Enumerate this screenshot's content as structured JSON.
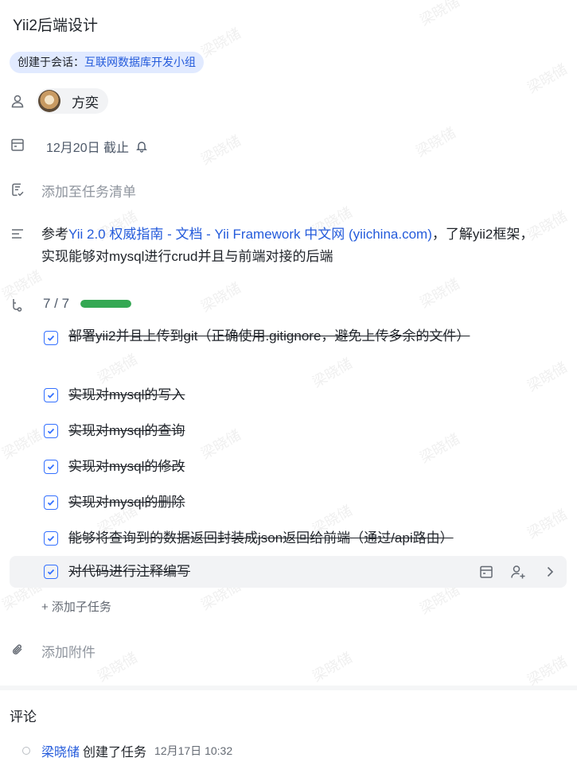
{
  "task": {
    "title": "Yii2后端设计",
    "chat_prefix": "创建于会话：",
    "chat_name": "互联网数据库开发小组",
    "assignee": "方奕",
    "due": "12月20日 截止",
    "add_to_list": "添加至任务清单",
    "description": {
      "prefix": "参考",
      "link_text": "Yii 2.0 权威指南 - 文档 - Yii Framework 中文网 (yiichina.com)",
      "suffix": "，了解yii2框架，实现能够对mysql进行crud并且与前端对接的后端"
    },
    "progress": {
      "label": "7 / 7",
      "fraction": 1.0,
      "color": "#34a853"
    },
    "subtasks": [
      {
        "text": "部署yii2并且上传到git（正确使用.gitignore，避免上传多余的文件）",
        "done": true
      },
      {
        "text": "实现对mysql的写入",
        "done": true
      },
      {
        "text": "实现对mysql的查询",
        "done": true
      },
      {
        "text": "实现对mysql的修改",
        "done": true
      },
      {
        "text": "实现对mysql的删除",
        "done": true
      },
      {
        "text": "能够将查询到的数据返回封装成json返回给前端（通过/api路由）",
        "done": true
      },
      {
        "text": "对代码进行注释编写",
        "done": true
      }
    ],
    "add_subtask": "+ 添加子任务",
    "add_attachment": "添加附件"
  },
  "comments": {
    "title": "评论",
    "activity": {
      "user": "梁晓储",
      "action": "创建了任务",
      "time": "12月17日 10:32"
    }
  },
  "watermark": "梁晓储",
  "icons": {
    "assignee": "user-icon",
    "due": "calendar-icon",
    "bell": "bell-icon",
    "list": "list-check-icon",
    "description": "text-lines-icon",
    "subtasks": "subtask-branch-icon",
    "attachment": "paperclip-icon",
    "row_actions": [
      "calendar-icon",
      "add-user-icon",
      "chevron-right-icon"
    ]
  },
  "colors": {
    "link": "#245bdb",
    "checkbox": "#3370ff",
    "tag_bg": "#e1eaff",
    "progress": "#34a853"
  }
}
